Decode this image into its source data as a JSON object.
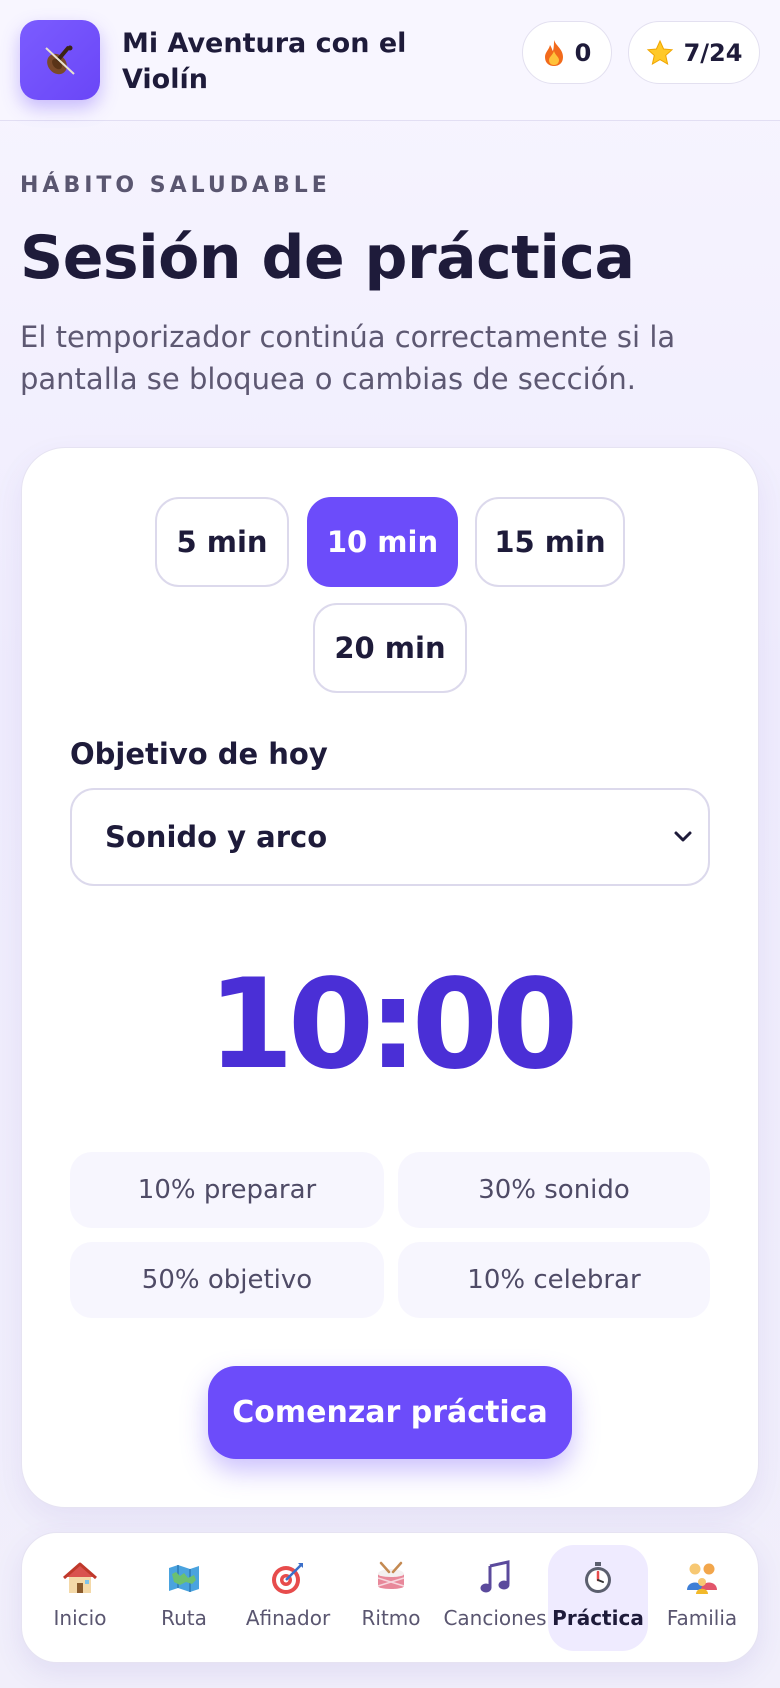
{
  "header": {
    "app_title": "Mi Aventura con el Violín",
    "logo_icon": "violin-icon",
    "streak": {
      "icon": "fire-icon",
      "value": "0"
    },
    "stars": {
      "icon": "star-icon",
      "value": "7/24"
    }
  },
  "intro": {
    "eyebrow": "HÁBITO SALUDABLE",
    "title": "Sesión de práctica",
    "subtitle": "El temporizador continúa correctamente si la pantalla se bloquea o cambias de sección."
  },
  "practice": {
    "durations": [
      {
        "label": "5 min",
        "selected": false
      },
      {
        "label": "10 min",
        "selected": true
      },
      {
        "label": "15 min",
        "selected": false
      },
      {
        "label": "20 min",
        "selected": false
      }
    ],
    "goal_label": "Objetivo de hoy",
    "goal_value": "Sonido y arco",
    "timer": "10:00",
    "breakdown": [
      "10% preparar",
      "30% sonido",
      "50% objetivo",
      "10% celebrar"
    ],
    "start_label": "Comenzar práctica"
  },
  "nav": {
    "items": [
      {
        "label": "Inicio",
        "icon": "house-icon"
      },
      {
        "label": "Ruta",
        "icon": "map-icon"
      },
      {
        "label": "Afinador",
        "icon": "target-icon"
      },
      {
        "label": "Ritmo",
        "icon": "drum-icon"
      },
      {
        "label": "Canciones",
        "icon": "music-note-icon"
      },
      {
        "label": "Práctica",
        "icon": "stopwatch-icon",
        "active": true
      },
      {
        "label": "Familia",
        "icon": "family-icon"
      }
    ]
  },
  "colors": {
    "accent": "#6c4cfa",
    "timer": "#4a2fd6",
    "text": "#1e1b3a",
    "muted": "#5d5872"
  }
}
